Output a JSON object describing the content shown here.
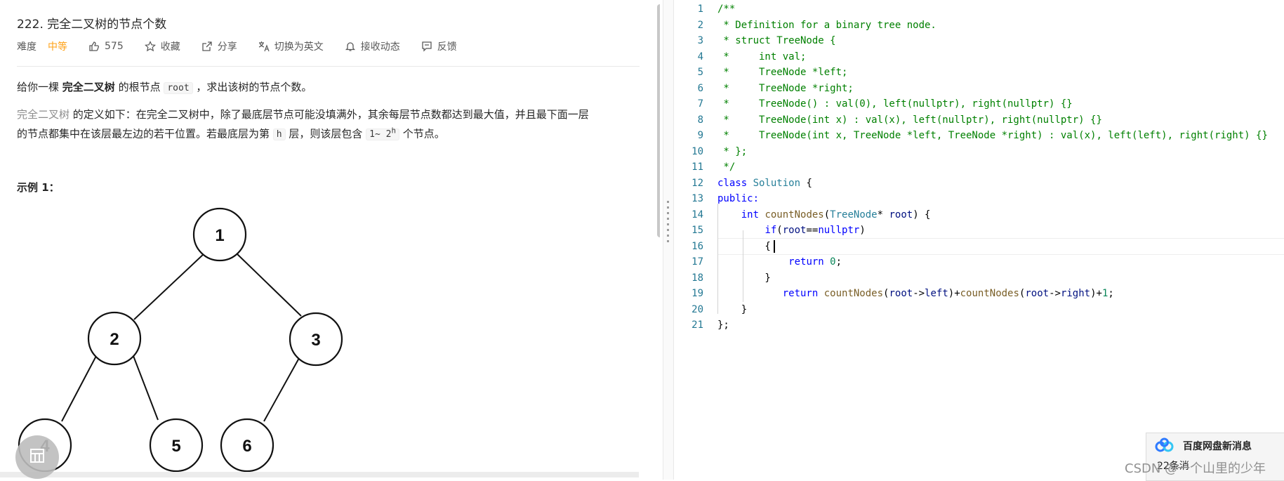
{
  "problem": {
    "title": "222. 完全二叉树的节点个数",
    "difficulty_label": "难度",
    "difficulty_value": "中等",
    "likes": "575",
    "favorite_label": "收藏",
    "share_label": "分享",
    "switch_lang_label": "切换为英文",
    "subscribe_label": "接收动态",
    "feedback_label": "反馈"
  },
  "description": {
    "p1_prefix": "给你一棵 ",
    "p1_bold": "完全二叉树",
    "p1_mid": " 的根节点 ",
    "p1_code": "root",
    "p1_suffix": " ，求出该树的节点个数。",
    "p2_link": "完全二叉树",
    "p2_line1": " 的定义如下：在完全二叉树中，除了最底层节点可能没填满外，其余每层节点数都达到最大值，并且最下面一层",
    "p2_line2_a": "的节点都集中在该层最左边的若干位置。若最底层为第 ",
    "p2_h": "h",
    "p2_line2_b": " 层，则该层包含 ",
    "p2_range": "1~ 2",
    "p2_sup": "h",
    "p2_line2_c": " 个节点。",
    "example_title": "示例 1："
  },
  "tree": {
    "nodes": [
      "1",
      "2",
      "3",
      "4",
      "5",
      "6"
    ]
  },
  "editor": {
    "line_numbers": [
      "1",
      "2",
      "3",
      "4",
      "5",
      "6",
      "7",
      "8",
      "9",
      "10",
      "11",
      "12",
      "13",
      "14",
      "15",
      "16",
      "17",
      "18",
      "19",
      "20",
      "21"
    ]
  },
  "notification": {
    "title": "百度网盘新消息",
    "subtitle": "22条消"
  },
  "watermark": "CSDN @一个山里的少年",
  "colors": {
    "difficulty": "#ffa116",
    "comment": "#008000",
    "keyword": "#0000ff",
    "type": "#267f99",
    "line_number": "#237893"
  }
}
